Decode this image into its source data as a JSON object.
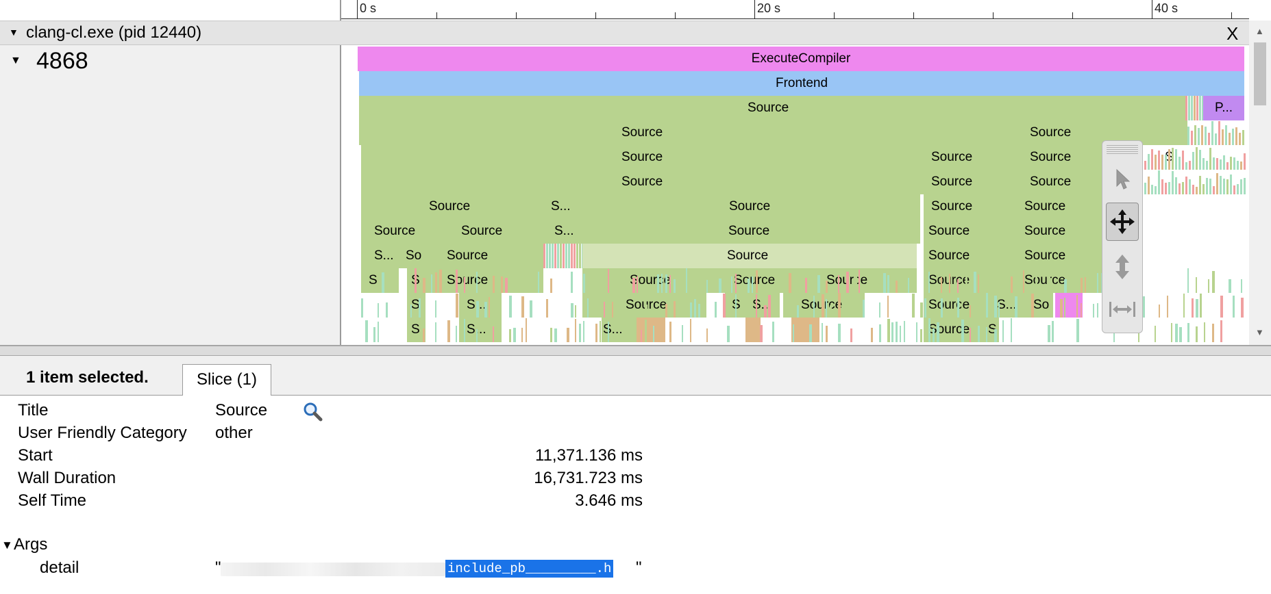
{
  "timeline": {
    "ruler_labels": [
      "0 s",
      "20 s",
      "40 s"
    ],
    "process_header": "clang-cl.exe (pid 12440)",
    "close_label": "X",
    "thread_id": "4868"
  },
  "flame": {
    "colors": {
      "compiler": "#ee88ee",
      "frontend": "#99c5f5",
      "source": "#b8d38f",
      "source_selected": "#d4e3b6",
      "purple": "#c18af0",
      "tan": "#deb887",
      "mint": "#a6dfc0",
      "pink": "#f0a0a0"
    },
    "labels": {
      "execute": "ExecuteCompiler",
      "frontend": "Frontend",
      "source": "Source",
      "source_short": "S...",
      "so": "So",
      "s": "S",
      "p_short": "P..."
    }
  },
  "mode_tool": {
    "items": [
      "selection-mode",
      "pan-mode",
      "zoom-mode",
      "timing-mode"
    ],
    "active": "pan-mode"
  },
  "analysis": {
    "selection_count": "1 item selected.",
    "tab_label": "Slice (1)",
    "props": {
      "title_label": "Title",
      "title_value": "Source",
      "category_label": "User Friendly Category",
      "category_value": "other",
      "start_label": "Start",
      "start_value": "11,371.136 ms",
      "wall_label": "Wall Duration",
      "wall_value": "16,731.723 ms",
      "self_label": "Self Time",
      "self_value": "3.646 ms",
      "args_label": "Args",
      "detail_label": "detail",
      "detail_open_quote": "\"",
      "detail_selected": "include_pb_________.h",
      "detail_close_quote": "\""
    }
  }
}
